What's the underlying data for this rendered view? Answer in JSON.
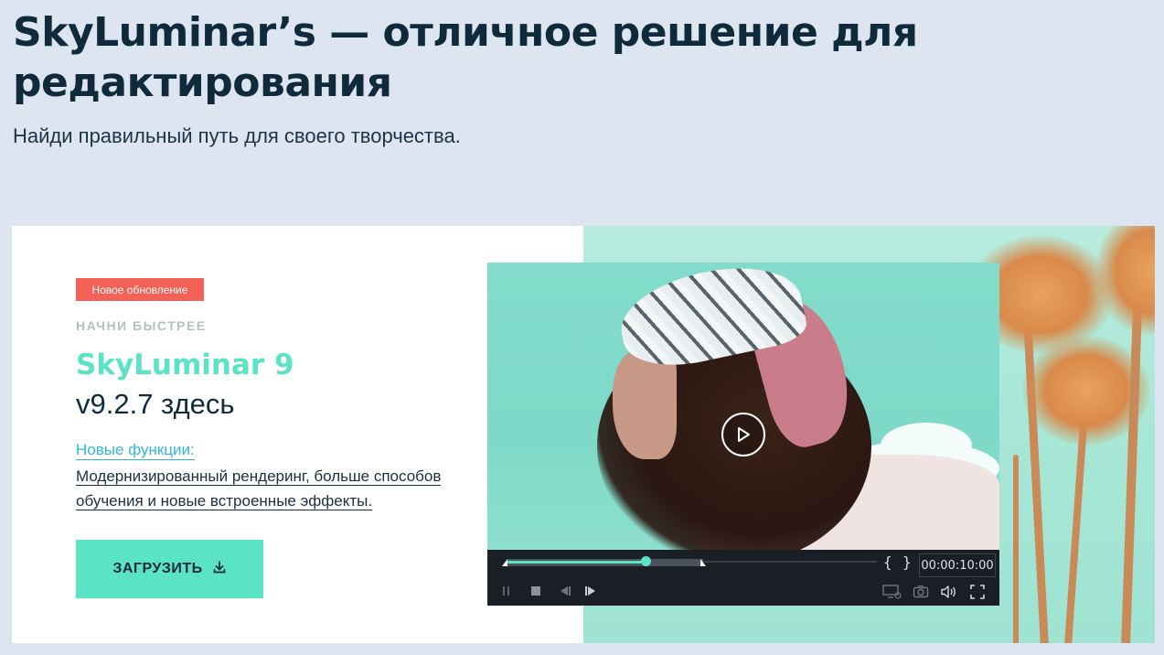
{
  "page": {
    "headline": "SkyLuminar’s — отличное решение для редактирования",
    "subheadline": "Найди правильный путь для своего творчества."
  },
  "promo": {
    "badge": "Новое обновление",
    "eyebrow": "НАЧНИ БЫСТРЕЕ",
    "product_name": "SkyLuminar 9",
    "version_line": "v9.2.7 здесь",
    "features_link": "Новые функции:",
    "features_desc": "Модернизированный рендеринг, больше способов обучения и новые встроенные эффекты.",
    "download_label": "ЗАГРУЗИТЬ",
    "download_icon": "download-icon"
  },
  "player": {
    "timecode": "00:00:10:00",
    "progress_fraction": 0.27,
    "play_icon": "play-icon",
    "controls": [
      "pause-icon",
      "stop-icon",
      "step-back-icon",
      "step-forward-icon",
      "screen-settings-icon",
      "snapshot-icon",
      "volume-icon",
      "fullscreen-icon"
    ],
    "mark_in": "{",
    "mark_out": "}"
  },
  "colors": {
    "background": "#dde5f1",
    "accent": "#5ae3c5",
    "badge": "#f46257",
    "link": "#2fb7d9",
    "heading": "#0e2a3b"
  }
}
